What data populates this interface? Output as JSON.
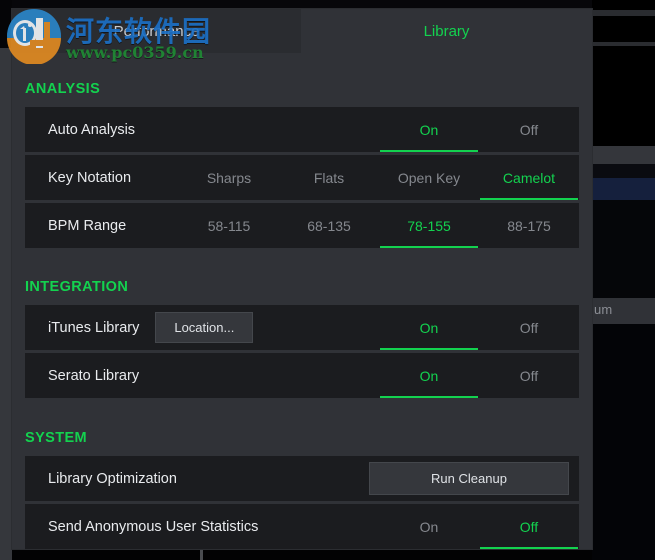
{
  "window": {
    "tabs": [
      {
        "label": "Performance",
        "active": false
      },
      {
        "label": "Library",
        "active": true
      }
    ]
  },
  "sections": [
    {
      "title": "ANALYSIS",
      "rows": [
        {
          "label": "Auto Analysis",
          "options": [
            "On",
            "Off"
          ],
          "selected": "On"
        },
        {
          "label": "Key Notation",
          "options": [
            "Sharps",
            "Flats",
            "Open Key",
            "Camelot"
          ],
          "selected": "Camelot"
        },
        {
          "label": "BPM Range",
          "options": [
            "58-115",
            "68-135",
            "78-155",
            "88-175"
          ],
          "selected": "78-155"
        }
      ]
    },
    {
      "title": "INTEGRATION",
      "rows": [
        {
          "label": "iTunes Library",
          "button": "Location...",
          "options": [
            "On",
            "Off"
          ],
          "selected": "On"
        },
        {
          "label": "Serato Library",
          "options": [
            "On",
            "Off"
          ],
          "selected": "On"
        }
      ]
    },
    {
      "title": "SYSTEM",
      "rows": [
        {
          "label": "Library Optimization",
          "button": "Run Cleanup"
        },
        {
          "label": "Send Anonymous User Statistics",
          "options": [
            "On",
            "Off"
          ],
          "selected": "Off"
        }
      ]
    }
  ],
  "watermark": {
    "chinese_text": "河东软件园",
    "url": "www.pc0359.cn"
  },
  "background": {
    "partial_text": "um"
  },
  "colors": {
    "accent_green": "#13d24f",
    "panel_bg": "#303237",
    "row_bg": "#1b1c1f",
    "muted_text": "#85888e",
    "label_text": "#e9ebee",
    "watermark_blue": "#1b6fc4",
    "watermark_green": "#1f8a34"
  }
}
